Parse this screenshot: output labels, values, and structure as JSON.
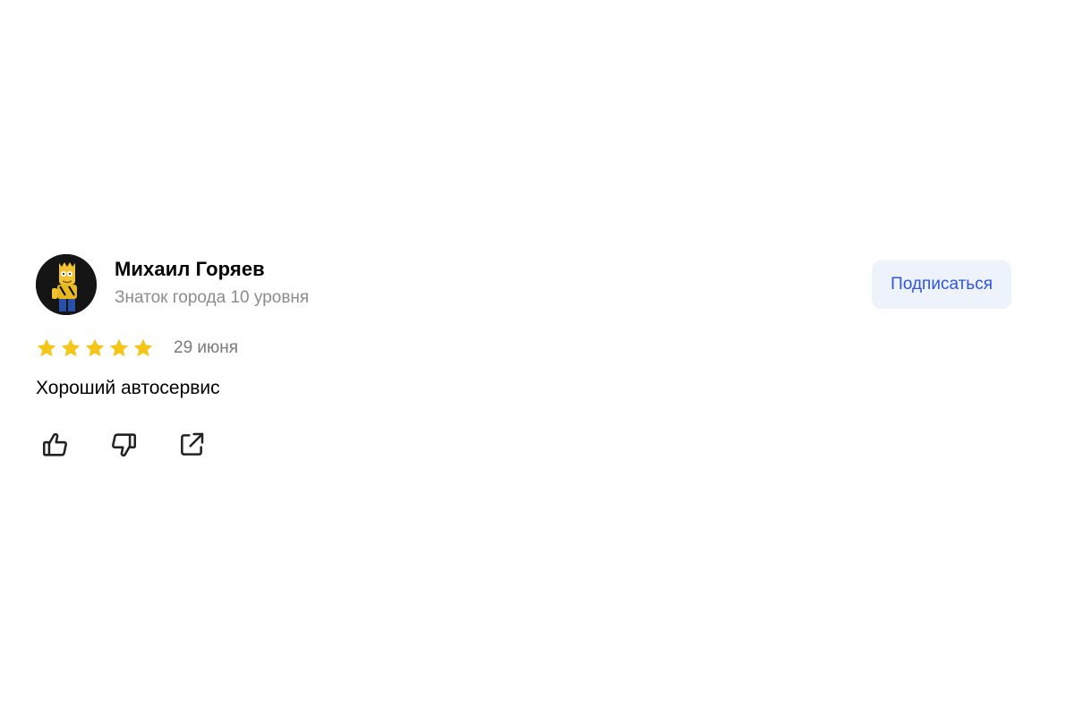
{
  "review": {
    "author_name": "Михаил Горяев",
    "author_level": "Знаток города 10 уровня",
    "subscribe_label": "Подписаться",
    "rating": 5,
    "rating_max": 5,
    "date": "29 июня",
    "text": "Хороший автосервис",
    "avatar_icon": "bart-simpson-avatar",
    "actions": [
      {
        "icon": "thumbs-up-icon"
      },
      {
        "icon": "thumbs-down-icon"
      },
      {
        "icon": "share-icon"
      }
    ]
  },
  "colors": {
    "star": "#f5c518",
    "accent": "#2e55e6",
    "button_bg": "#eef2fb",
    "muted": "#8c8c8c"
  }
}
